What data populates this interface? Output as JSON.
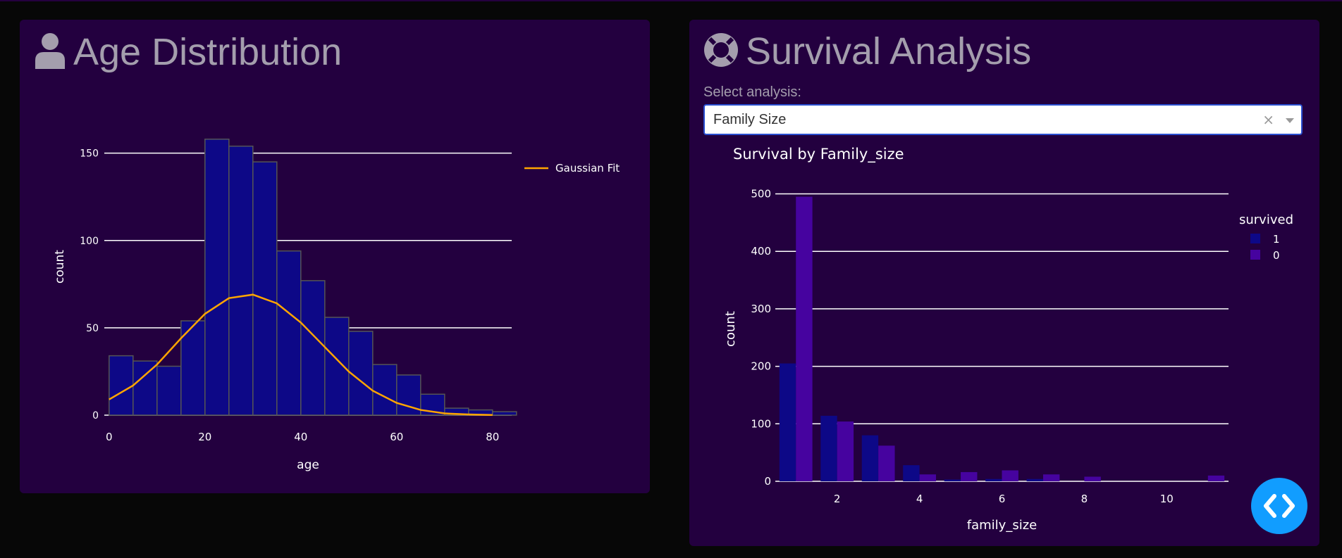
{
  "age_panel": {
    "title": "Age Distribution",
    "icon": "user-icon"
  },
  "survival_panel": {
    "title": "Survival Analysis",
    "icon": "life-ring-icon",
    "select_label": "Select analysis:",
    "select_value": "Family Size",
    "clear_glyph": "×"
  },
  "colors": {
    "bar_blue": "#0d0887",
    "bar_purple": "#46039f",
    "gaussian": "#ffa500",
    "panel_bg": "#23003f",
    "page_bg": "#070707",
    "fab": "#119dff"
  },
  "chart_data": [
    {
      "type": "bar",
      "title": "",
      "xlabel": "age",
      "ylabel": "count",
      "bin_edges": [
        0,
        5,
        10,
        15,
        20,
        25,
        30,
        35,
        40,
        45,
        50,
        55,
        60,
        65,
        70,
        75,
        80,
        85
      ],
      "values": [
        34,
        31,
        28,
        54,
        158,
        154,
        145,
        94,
        77,
        56,
        48,
        29,
        23,
        12,
        4,
        3,
        2
      ],
      "xticks": [
        0,
        20,
        40,
        60,
        80
      ],
      "yticks": [
        0,
        50,
        100,
        150
      ],
      "xlim": [
        -1,
        84
      ],
      "ylim": [
        0,
        170
      ],
      "grid": true,
      "legend": "top-right",
      "series": [
        {
          "name": "Gaussian Fit",
          "type": "line",
          "x": [
            0,
            5,
            10,
            15,
            20,
            25,
            30,
            35,
            40,
            45,
            50,
            55,
            60,
            65,
            70,
            75,
            80
          ],
          "y": [
            9,
            17,
            29,
            44,
            58,
            67,
            69,
            64,
            53,
            39,
            25,
            14,
            7,
            3,
            1,
            0.4,
            0.1
          ]
        }
      ]
    },
    {
      "type": "bar",
      "title": "Survival by Family_size",
      "xlabel": "family_size",
      "ylabel": "count",
      "legend_title": "survived",
      "categories": [
        1,
        2,
        3,
        4,
        5,
        6,
        7,
        8,
        11
      ],
      "series": [
        {
          "name": "1",
          "values": [
            205,
            114,
            80,
            28,
            3,
            4,
            4,
            0,
            0
          ]
        },
        {
          "name": "0",
          "values": [
            495,
            104,
            62,
            12,
            16,
            19,
            12,
            8,
            10
          ]
        }
      ],
      "xticks": [
        2,
        4,
        6,
        8,
        10
      ],
      "yticks": [
        0,
        100,
        200,
        300,
        400,
        500
      ],
      "xlim": [
        0.5,
        11.5
      ],
      "ylim": [
        0,
        530
      ],
      "grid": true,
      "legend": "top-right"
    }
  ]
}
